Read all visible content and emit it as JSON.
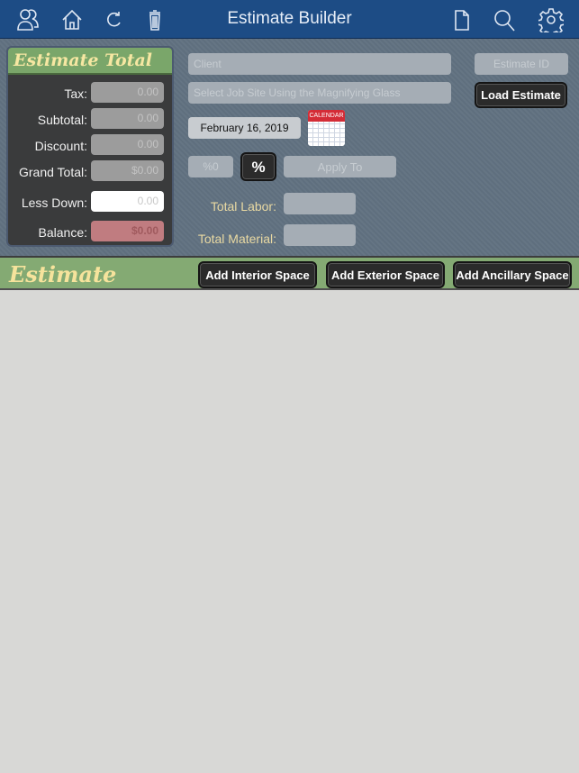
{
  "nav": {
    "title": "Estimate Builder",
    "icons": [
      "users-icon",
      "home-icon",
      "refresh-icon",
      "trash-icon",
      "document-icon",
      "search-icon",
      "gear-icon"
    ]
  },
  "totals": {
    "header": "Estimate Total",
    "rows": [
      {
        "label": "Tax:",
        "value": "0.00"
      },
      {
        "label": "Subtotal:",
        "value": "0.00"
      },
      {
        "label": "Discount:",
        "value": "0.00"
      },
      {
        "label": "Grand Total:",
        "value": "$0.00"
      },
      {
        "label": "Less Down:",
        "value": "0.00"
      },
      {
        "label": "Balance:",
        "value": "$0.00"
      }
    ]
  },
  "form": {
    "client_placeholder": "Client",
    "jobsite_placeholder": "Select Job Site Using the Magnifying Glass",
    "estimate_id_placeholder": "Estimate ID",
    "load_label": "Load Estimate",
    "date": "February 16, 2019",
    "calendar_label": "CALENDAR",
    "percent_placeholder": "%0",
    "percent_button": "%",
    "apply_to": "Apply To",
    "total_labor": "Total Labor:",
    "total_material": "Total Material:"
  },
  "estimate": {
    "title": "Estimate",
    "buttons": [
      "Add Interior Space",
      "Add Exterior Space",
      "Add Ancillary Space"
    ]
  },
  "colors": {
    "nav": "#1d4c85",
    "header_green": "#7aa66a",
    "balance": "#c07c80"
  }
}
